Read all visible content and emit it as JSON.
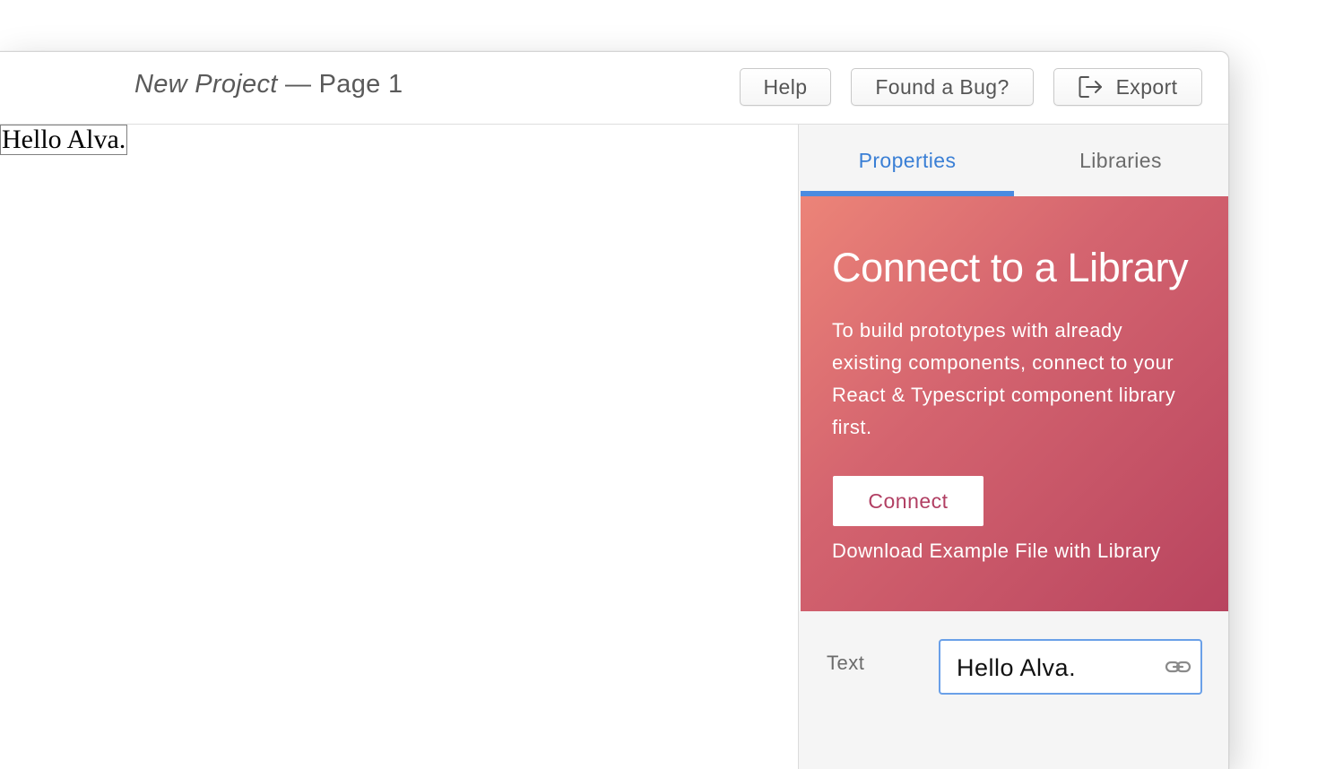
{
  "window": {
    "title_project": "New Project",
    "title_separator": " — ",
    "title_page": "Page 1"
  },
  "toolbar": {
    "help_label": "Help",
    "bug_label": "Found a Bug?",
    "export_label": "Export",
    "export_icon": "export-icon"
  },
  "canvas": {
    "element_text": "Hello Alva."
  },
  "sidebar": {
    "tabs": [
      {
        "label": "Properties",
        "active": true
      },
      {
        "label": "Libraries",
        "active": false
      }
    ],
    "connect": {
      "title": "Connect to a Library",
      "description": "To build prototypes with already existing components, connect to your React & Typescript component library first.",
      "button_label": "Connect",
      "download_label": "Download Example File with Library"
    },
    "property": {
      "label": "Text",
      "value": "Hello Alva.",
      "icon": "link-icon"
    }
  },
  "colors": {
    "accent": "#4a8be0",
    "panel_gradient_start": "#ec8478",
    "panel_gradient_end": "#b8445f",
    "connect_text": "#b13f63"
  }
}
